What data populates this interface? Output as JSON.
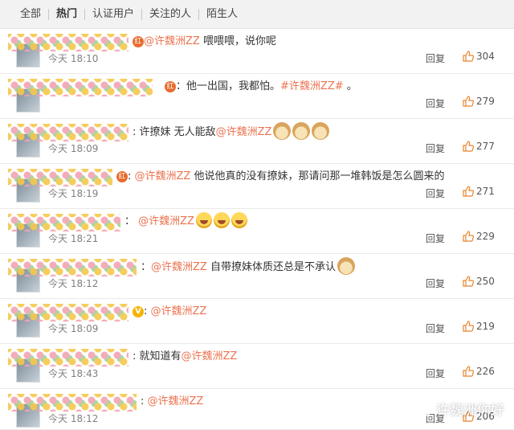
{
  "tabs": [
    "全部",
    "热门",
    "认证用户",
    "关注的人",
    "陌生人"
  ],
  "active_tab": "热门",
  "comments": [
    {
      "parts": [
        {
          "t": "@许魏洲ZZ",
          "m": true
        },
        {
          "t": " 喂喂喂，说你呢"
        }
      ],
      "time": "今天 18:10",
      "reply": "回复",
      "likes": "304",
      "badge": "red"
    },
    {
      "parts": [
        {
          "t": "：他一出国，我都怕。"
        },
        {
          "t": "#许魏洲ZZ#",
          "m": true
        },
        {
          "t": " 。"
        }
      ],
      "time": "",
      "reply": "回复",
      "likes": "279",
      "badge": "red"
    },
    {
      "parts": [
        {
          "t": ": 许撩妹  无人能敌"
        },
        {
          "t": "@许魏洲ZZ",
          "m": true
        }
      ],
      "time": "今天 18:09",
      "reply": "回复",
      "likes": "277",
      "emoji": "doge3"
    },
    {
      "parts": [
        {
          "t": ": "
        },
        {
          "t": "@许魏洲ZZ",
          "m": true
        },
        {
          "t": " 他说他真的没有撩妹，那请问那一堆韩饭是怎么圆来的"
        }
      ],
      "time": "今天 18:19",
      "reply": "回复",
      "likes": "271",
      "badge": "red"
    },
    {
      "parts": [
        {
          "t": "： "
        },
        {
          "t": "@许魏洲ZZ",
          "m": true
        }
      ],
      "time": "今天 18:21",
      "reply": "回复",
      "likes": "229",
      "emoji": "laugh3"
    },
    {
      "parts": [
        {
          "t": "："
        },
        {
          "t": "@许魏洲ZZ",
          "m": true
        },
        {
          "t": " 自带撩妹体质还总是不承认"
        }
      ],
      "time": "今天 18:12",
      "reply": "回复",
      "likes": "250",
      "emoji": "one"
    },
    {
      "parts": [
        {
          "t": ": "
        },
        {
          "t": "@许魏洲ZZ",
          "m": true
        }
      ],
      "time": "今天 18:09",
      "reply": "回复",
      "likes": "219",
      "badge": "v"
    },
    {
      "parts": [
        {
          "t": ": 就知道有"
        },
        {
          "t": "@许魏洲ZZ",
          "m": true
        }
      ],
      "time": "今天 18:43",
      "reply": "回复",
      "likes": "226"
    },
    {
      "parts": [
        {
          "t": ": "
        },
        {
          "t": "@许魏洲ZZ",
          "m": true
        }
      ],
      "time": "今天 18:12",
      "reply": "回复",
      "likes": "206"
    }
  ],
  "watermark": "许魏洲你好"
}
